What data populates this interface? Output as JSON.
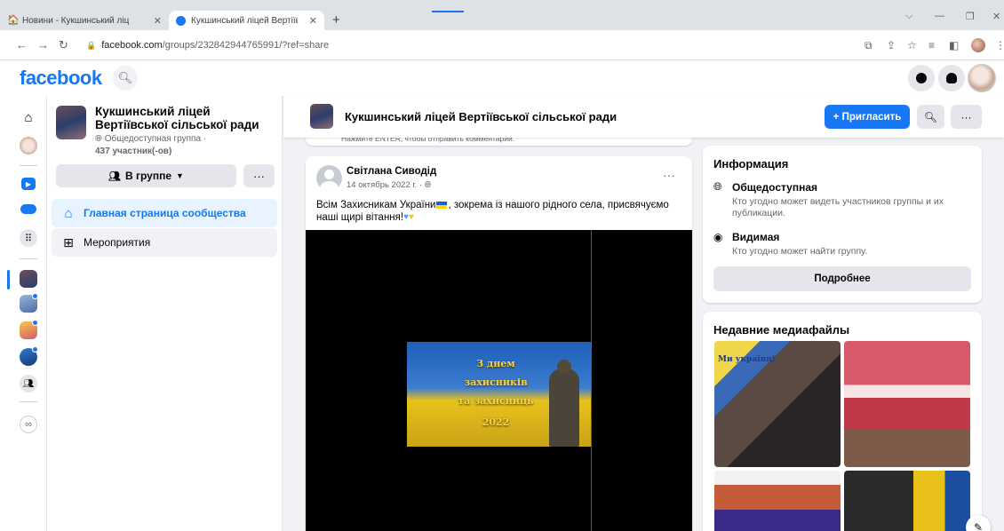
{
  "browser": {
    "tabs": [
      {
        "label": "Новини - Кукшинський ліцей Ве",
        "active": false
      },
      {
        "label": "Кукшинський ліцей Вертіївсько",
        "active": true
      }
    ],
    "new_tab": "+",
    "url_host": "facebook.com",
    "url_path": "/groups/232842944765991/?ref=share"
  },
  "fb": {
    "logo": "facebook"
  },
  "group": {
    "name": "Кукшинський ліцей Вертіївської сільської ради",
    "privacy": "Общедоступная группа ·",
    "members": "437 участник(-ов)",
    "in_group_label": "В группе",
    "more": "···",
    "nav": [
      {
        "label": "Главная страница сообщества",
        "icon": "home-icon",
        "active": true
      },
      {
        "label": "Мероприятия",
        "icon": "calendar-grid-icon",
        "active": false
      }
    ],
    "invite_label": "+ Пригласить"
  },
  "prev_comment_hint": "Нажмите ENTER, чтобы отправить комментарии.",
  "post": {
    "author": "Світлана Сиводід",
    "date": "14 октябрь 2022 г. ·",
    "text_before_flag": "Всім Захисникам України",
    "text_after_flag": ", зокрема із нашого рідного села, присвячуємо наші щирі вітання!",
    "image_text": [
      "З днем",
      "захисників",
      "та захисниць",
      "2022"
    ]
  },
  "info": {
    "title": "Информация",
    "public_title": "Общедоступная",
    "public_desc": "Кто угодно может видеть участников группы и их публикации.",
    "visible_title": "Видимая",
    "visible_desc": "Кто угодно может найти группу.",
    "details_button": "Подробнее"
  },
  "media": {
    "title": "Недавние медиафайлы",
    "thumb1_caption": "Ми українці"
  },
  "colors": {
    "brand": "#1877f2",
    "active_nav_bg": "#e7f3ff",
    "page_bg": "#f0f2f5"
  }
}
